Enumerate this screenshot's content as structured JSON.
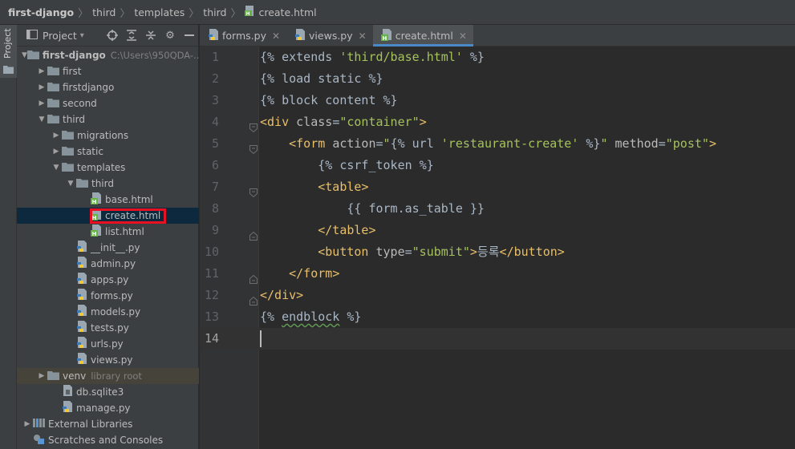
{
  "breadcrumb": {
    "items": [
      "first-django",
      "third",
      "templates",
      "third",
      "create.html"
    ]
  },
  "tool_stripe": {
    "label": "Project"
  },
  "project_panel": {
    "title": "Project",
    "tree": [
      {
        "label": "first-django",
        "extra": "C:\\Users\\950QDA-...",
        "indent": 0,
        "arrow": "down",
        "icon": "folder",
        "bold": true
      },
      {
        "label": "first",
        "indent": 1,
        "arrow": "right",
        "icon": "folder"
      },
      {
        "label": "firstdjango",
        "indent": 1,
        "arrow": "right",
        "icon": "folder"
      },
      {
        "label": "second",
        "indent": 1,
        "arrow": "right",
        "icon": "folder"
      },
      {
        "label": "third",
        "indent": 1,
        "arrow": "down",
        "icon": "folder"
      },
      {
        "label": "migrations",
        "indent": 2,
        "arrow": "right",
        "icon": "folder"
      },
      {
        "label": "static",
        "indent": 2,
        "arrow": "right",
        "icon": "folder"
      },
      {
        "label": "templates",
        "indent": 2,
        "arrow": "down",
        "icon": "folder"
      },
      {
        "label": "third",
        "indent": 3,
        "arrow": "down",
        "icon": "folder"
      },
      {
        "label": "base.html",
        "indent": 4,
        "arrow": "",
        "icon": "html"
      },
      {
        "label": "create.html",
        "indent": 4,
        "arrow": "",
        "icon": "html",
        "selected": true
      },
      {
        "label": "list.html",
        "indent": 4,
        "arrow": "",
        "icon": "html"
      },
      {
        "label": "__init__.py",
        "indent": 3,
        "arrow": "",
        "icon": "py"
      },
      {
        "label": "admin.py",
        "indent": 3,
        "arrow": "",
        "icon": "py"
      },
      {
        "label": "apps.py",
        "indent": 3,
        "arrow": "",
        "icon": "py"
      },
      {
        "label": "forms.py",
        "indent": 3,
        "arrow": "",
        "icon": "py"
      },
      {
        "label": "models.py",
        "indent": 3,
        "arrow": "",
        "icon": "py"
      },
      {
        "label": "tests.py",
        "indent": 3,
        "arrow": "",
        "icon": "py"
      },
      {
        "label": "urls.py",
        "indent": 3,
        "arrow": "",
        "icon": "py"
      },
      {
        "label": "views.py",
        "indent": 3,
        "arrow": "",
        "icon": "py"
      },
      {
        "label": "venv",
        "extra": "library root",
        "indent": 1,
        "arrow": "right",
        "icon": "folder",
        "venv": true
      },
      {
        "label": "db.sqlite3",
        "indent": 2,
        "arrow": "",
        "icon": "db"
      },
      {
        "label": "manage.py",
        "indent": 2,
        "arrow": "",
        "icon": "py"
      },
      {
        "label": "External Libraries",
        "indent": 0,
        "arrow": "right",
        "icon": "libs"
      },
      {
        "label": "Scratches and Consoles",
        "indent": 0,
        "arrow": "",
        "icon": "scratch"
      }
    ]
  },
  "tabs": [
    {
      "label": "forms.py",
      "icon": "py",
      "active": false
    },
    {
      "label": "views.py",
      "icon": "py",
      "active": false
    },
    {
      "label": "create.html",
      "icon": "html",
      "active": true
    }
  ],
  "editor": {
    "current_line": 14,
    "lines": [
      {
        "num": "1",
        "text": "{% extends 'third/base.html' %}"
      },
      {
        "num": "2",
        "text": "{% load static %}"
      },
      {
        "num": "3",
        "text": "{% block content %}"
      },
      {
        "num": "4",
        "text": "<div class=\"container\">"
      },
      {
        "num": "5",
        "text": "    <form action=\"{% url 'restaurant-create' %}\" method=\"post\">"
      },
      {
        "num": "6",
        "text": "        {% csrf_token %}"
      },
      {
        "num": "7",
        "text": "        <table>"
      },
      {
        "num": "8",
        "text": "            {{ form.as_table }}"
      },
      {
        "num": "9",
        "text": "        </table>"
      },
      {
        "num": "10",
        "text": "        <button type=\"submit\">등록</button>"
      },
      {
        "num": "11",
        "text": "    </form>"
      },
      {
        "num": "12",
        "text": "</div>"
      },
      {
        "num": "13",
        "text": "{% endblock %}"
      },
      {
        "num": "14",
        "text": ""
      }
    ]
  },
  "colors": {
    "background": "#2b2b2b",
    "panel": "#3c3f41",
    "selection": "#0d293e",
    "highlight_box": "#e81123",
    "tab_accent": "#4a88c7"
  }
}
